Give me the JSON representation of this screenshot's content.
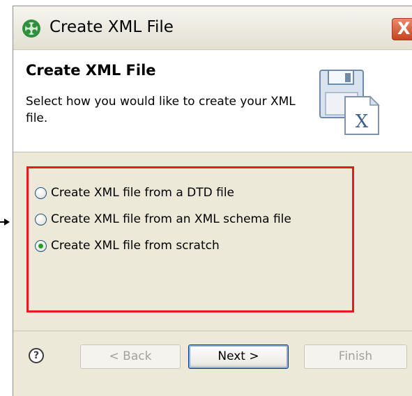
{
  "window": {
    "title": "Create XML File",
    "close_label": "X"
  },
  "banner": {
    "title": "Create XML File",
    "description": "Select how you would like to create your XML file."
  },
  "options": [
    {
      "label": "Create XML file from a DTD file",
      "checked": false
    },
    {
      "label": "Create XML file from an XML schema file",
      "checked": false
    },
    {
      "label": "Create XML file from scratch",
      "checked": true
    }
  ],
  "footer": {
    "help_label": "?",
    "back_label": "< Back",
    "next_label": "Next >",
    "finish_label": "Finish",
    "back_enabled": false,
    "next_enabled": true,
    "finish_enabled": false
  },
  "colors": {
    "highlight_border": "#e51b1b",
    "radio_selected": "#21a121",
    "dialog_background": "#ece9d8"
  },
  "icons": {
    "title": "wizard-icon",
    "banner": "xml-file-save-icon",
    "help": "help-icon",
    "callout": "callout-arrow-icon"
  }
}
